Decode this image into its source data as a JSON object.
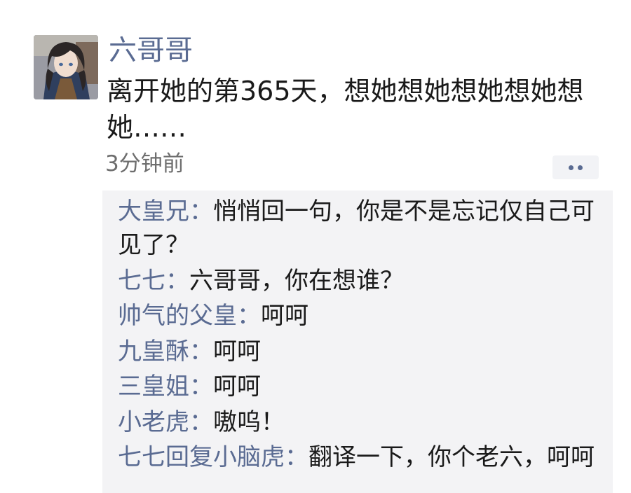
{
  "post": {
    "author": "六哥哥",
    "content": "离开她的第365天，想她想她想她想她想她……",
    "time": "3分钟前",
    "more_icon": "more-dots-icon",
    "avatar_icon": "anime-character-avatar",
    "link_color": "#5a6b92"
  },
  "comments": [
    {
      "name": "大皇兄",
      "sep": "：",
      "text": "悄悄回一句，你是不是忘记仅自己可见了？"
    },
    {
      "name": "七七",
      "sep": "：",
      "text": "六哥哥，你在想谁？"
    },
    {
      "name": "帅气的父皇",
      "sep": "：",
      "text": "呵呵"
    },
    {
      "name": "九皇酥",
      "sep": "：",
      "text": "呵呵"
    },
    {
      "name": "三皇姐",
      "sep": "：",
      "text": "呵呵"
    },
    {
      "name": "小老虎",
      "sep": "：",
      "text": "嗷呜！"
    },
    {
      "name": "七七回复小脑虎",
      "sep": "：",
      "text": "翻译一下，你个老六，呵呵"
    }
  ]
}
